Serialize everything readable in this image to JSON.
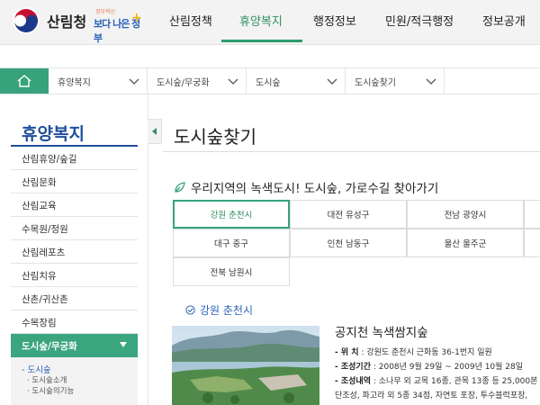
{
  "header": {
    "logo_name": "산림청",
    "slogan_small": "정부혁신",
    "slogan_big": "보다 나은 정부",
    "nav": [
      {
        "label": "산림정책"
      },
      {
        "label": "휴양복지"
      },
      {
        "label": "행정정보"
      },
      {
        "label": "민원/적극행정"
      },
      {
        "label": "정보공개"
      }
    ]
  },
  "breadcrumb": [
    "휴양복지",
    "도시숲/무궁화",
    "도시숲",
    "도시숲찾기"
  ],
  "sidebar": {
    "title": "휴양복지",
    "items": [
      "산림휴양/숲길",
      "산림문화",
      "산림교육",
      "수목원/정원",
      "산림레포츠",
      "산림치유",
      "산촌/귀산촌",
      "수목장림"
    ],
    "active": "도시숲/무궁화",
    "sub_item": "- 도시숲",
    "sub_sub": [
      "· 도시숲소개",
      "· 도시숲의기능"
    ]
  },
  "main": {
    "page_title": "도시숲찾기",
    "section_title": "우리지역의 녹색도시! 도시숲, 가로수길 찾아가기",
    "regions": [
      "강원 춘천시",
      "대전 유성구",
      "전남 광양시",
      "대구 중구",
      "인천 남동구",
      "울산 울주군",
      "전북 남원시"
    ],
    "active_region": "강원 춘천시"
  },
  "park": {
    "title": "공지천 녹색쌈지숲",
    "rows": [
      {
        "key": "- 위      치",
        "value": " : 강원도 춘천시 근화동 36-1번지 일원"
      },
      {
        "key": "- 조성기간",
        "value": " : 2008년 9월 29일 ~ 2009년 10월 28일"
      },
      {
        "key": "- 조성내역",
        "value": " : 소나무 외 교목 16종, 관목 13종 등 25,000본"
      },
      {
        "key": "",
        "value": "단조성, 파고라 외 5종 34점, 자연토 포장, 투수블럭포장,"
      }
    ]
  },
  "colors": {
    "green": "#37a27b",
    "blue": "#2a62b8",
    "navy": "#1f4e9c"
  }
}
